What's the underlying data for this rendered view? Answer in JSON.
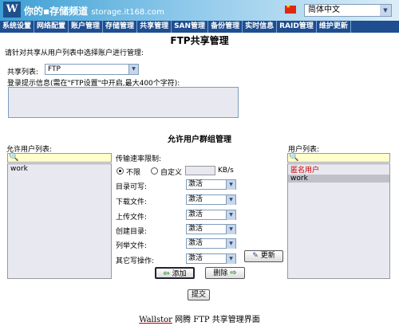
{
  "header": {
    "logo_text": "W",
    "slogan": "你的▪存储频道",
    "site": "storage.it168.com",
    "language": "简体中文"
  },
  "nav": {
    "items": [
      "系统设置",
      "网络配置",
      "账户管理",
      "存储管理",
      "共享管理",
      "SAN管理",
      "备份管理",
      "实时信息",
      "RAID管理",
      "维护更新"
    ]
  },
  "page": {
    "title": "FTP共享管理",
    "instruction": "请针对共享从用户列表中选择账户进行管理:"
  },
  "share": {
    "label": "共享列表:",
    "selected": "FTP"
  },
  "login": {
    "label": "登录提示信息(需在\"FTP设置\"中开启,最大400个字符):"
  },
  "group": {
    "title": "允许用户群组管理"
  },
  "allowed": {
    "label": "允许用户列表:",
    "items": [
      "work"
    ]
  },
  "rate": {
    "label": "传输速率限制:",
    "option_unlimited": "不限",
    "option_custom": "自定义",
    "unit": "KB/s"
  },
  "permissions": [
    {
      "label": "目录可写:",
      "value": "激活"
    },
    {
      "label": "下载文件:",
      "value": "激活"
    },
    {
      "label": "上传文件:",
      "value": "激活"
    },
    {
      "label": "创建目录:",
      "value": "激活"
    },
    {
      "label": "列举文件:",
      "value": "激活"
    },
    {
      "label": "其它写操作:",
      "value": "激活"
    }
  ],
  "buttons": {
    "refresh": "更新",
    "add": "添加",
    "remove": "删除",
    "submit": "提交"
  },
  "users": {
    "label": "用户列表:",
    "anonymous": "匿名用户",
    "items": [
      "work"
    ]
  },
  "caption": {
    "brand": "Wallstor",
    "text": "网腾 FTP 共享管理界面"
  }
}
